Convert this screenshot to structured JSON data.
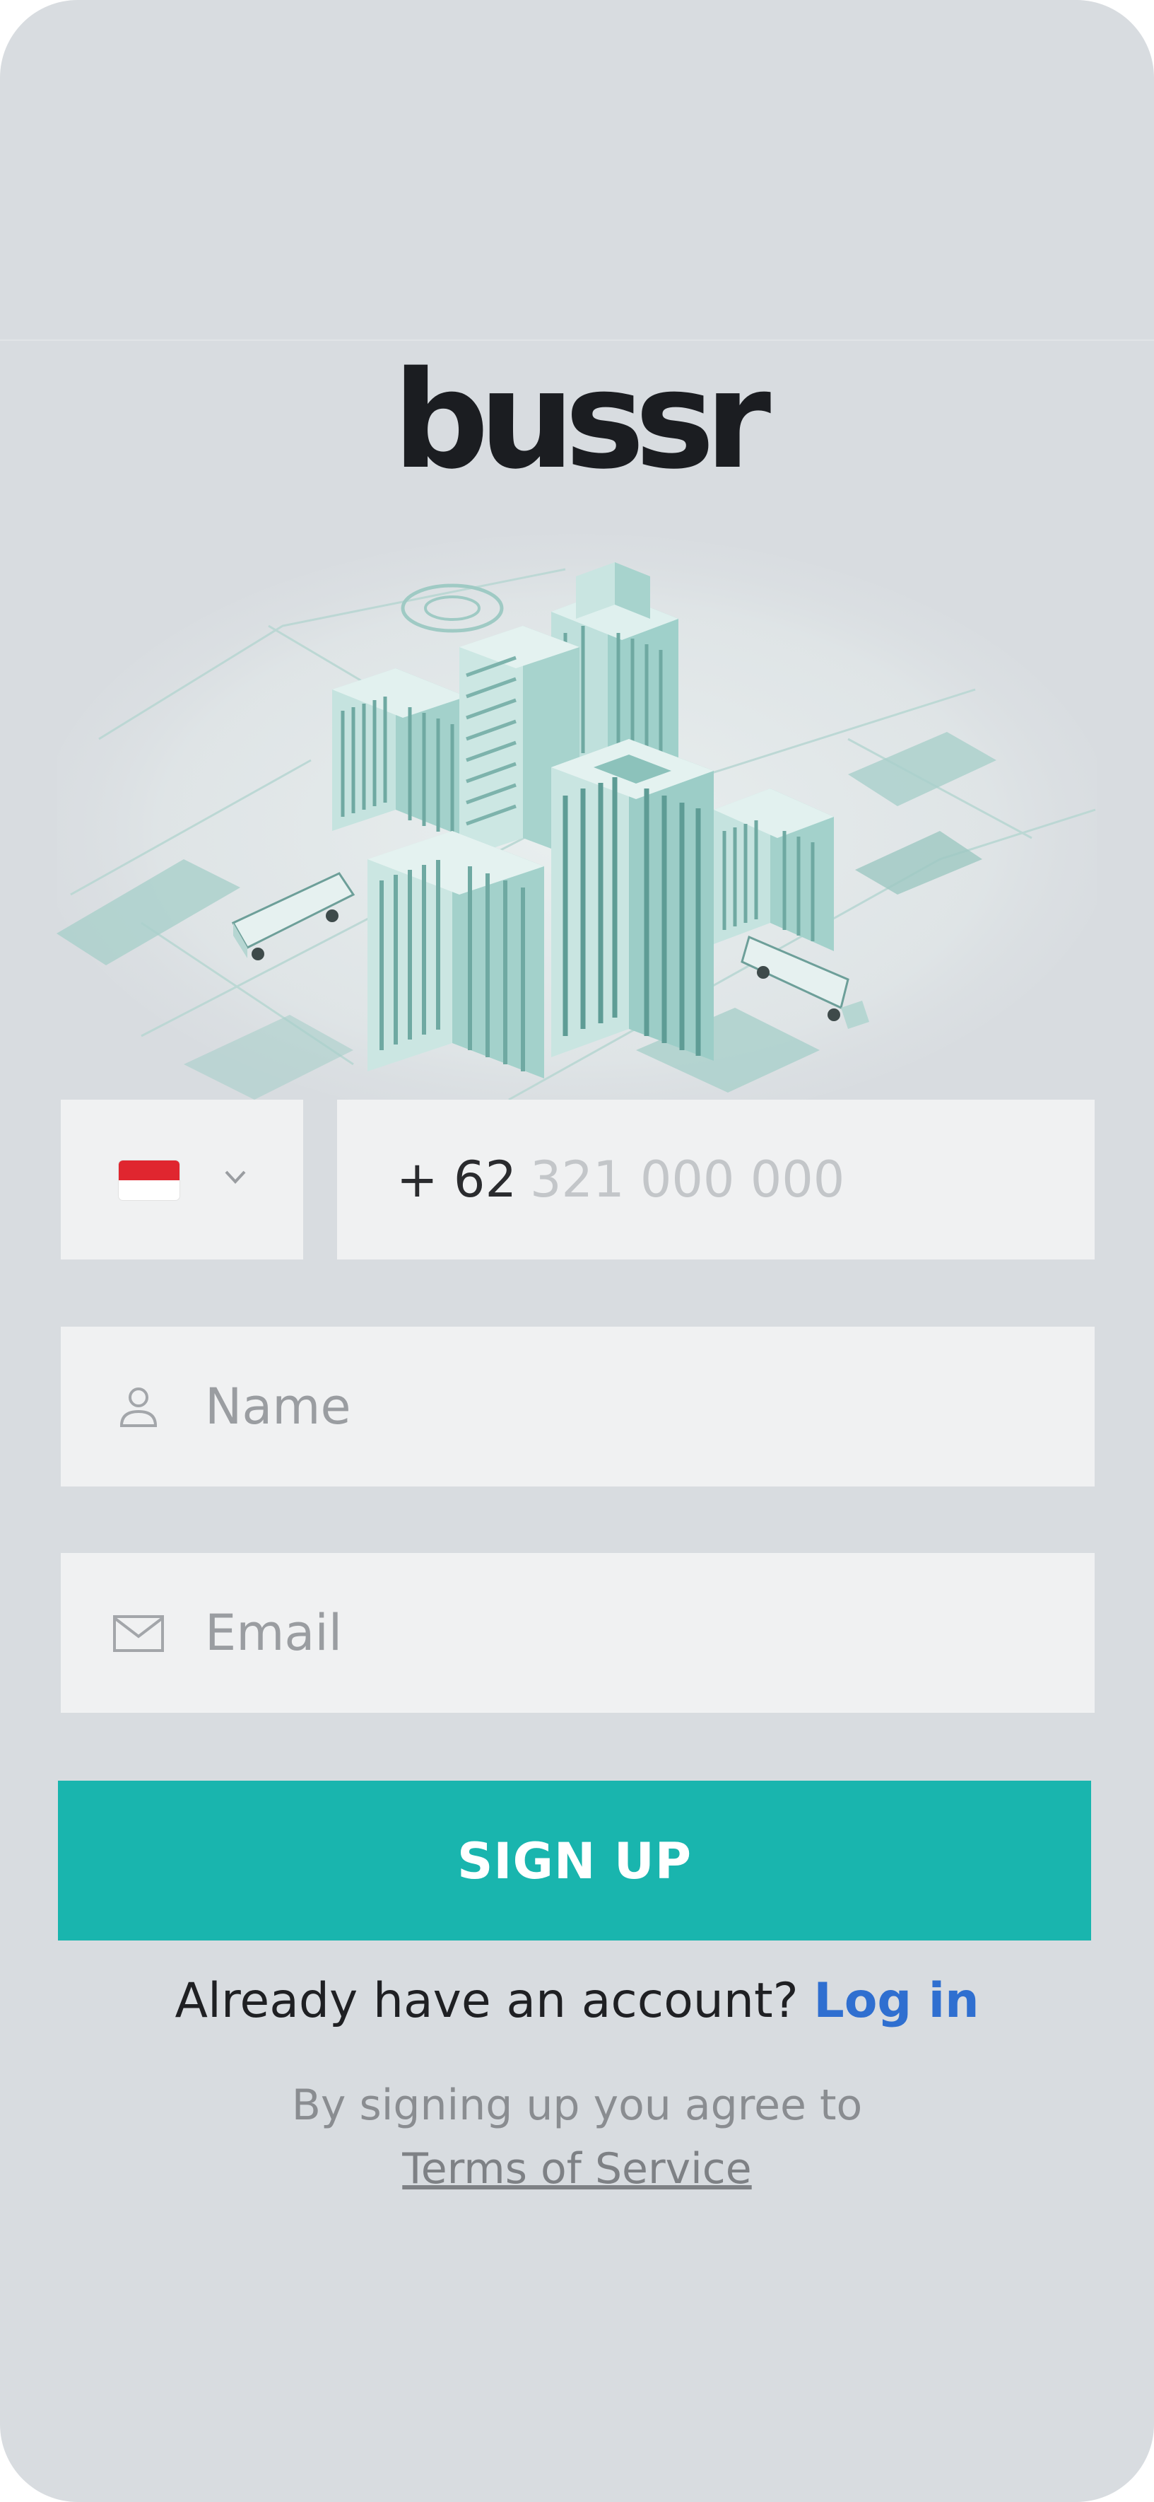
{
  "brand": {
    "logo_text": "bussr"
  },
  "illustration": {
    "name": "isometric-city-with-buses"
  },
  "phone": {
    "country_flag": "indonesia-flag-icon",
    "dropdown_icon": "chevron-down-icon",
    "prefix": "+ 62",
    "placeholder": "321 000 000"
  },
  "name_field": {
    "icon": "person-icon",
    "placeholder": "Name"
  },
  "email_field": {
    "icon": "envelope-icon",
    "placeholder": "Email"
  },
  "signup_button": {
    "label": "SIGN UP",
    "color": "#19b5ae"
  },
  "login": {
    "prompt": "Already have an account?",
    "link_label": "Log in",
    "link_color": "#2f6fd0"
  },
  "terms": {
    "text": "By signing up you agree to",
    "link_label": "Terms of Service"
  }
}
